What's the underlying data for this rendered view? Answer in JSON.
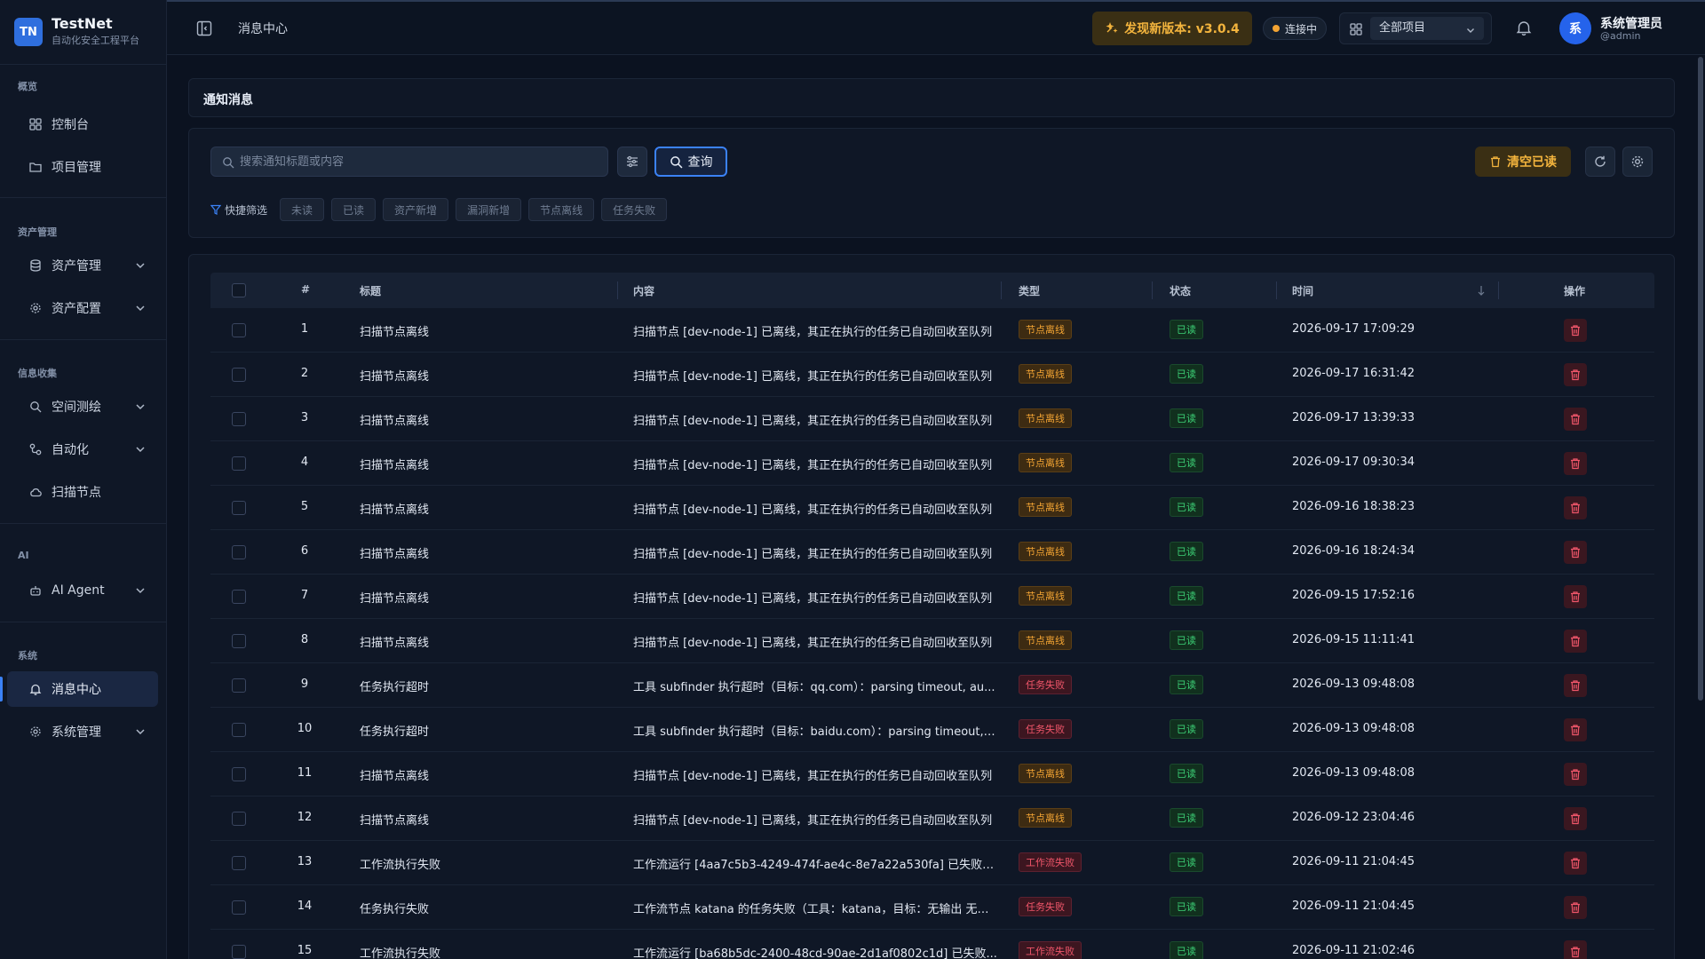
{
  "brand": {
    "logo": "TN",
    "name": "TestNet",
    "subtitle": "自动化安全工程平台"
  },
  "sidebar": {
    "groups": [
      {
        "label": "概览",
        "items": [
          {
            "label": "控制台",
            "icon": "dashboard-icon"
          },
          {
            "label": "项目管理",
            "icon": "folder-icon"
          }
        ]
      },
      {
        "label": "资产管理",
        "items": [
          {
            "label": "资产管理",
            "icon": "database-icon",
            "expandable": true
          },
          {
            "label": "资产配置",
            "icon": "gear-icon",
            "expandable": true
          }
        ]
      },
      {
        "label": "信息收集",
        "items": [
          {
            "label": "空间测绘",
            "icon": "search-icon",
            "expandable": true
          },
          {
            "label": "自动化",
            "icon": "workflow-icon",
            "expandable": true
          },
          {
            "label": "扫描节点",
            "icon": "cloud-icon"
          }
        ]
      },
      {
        "label": "AI",
        "items": [
          {
            "label": "AI Agent",
            "icon": "robot-icon",
            "expandable": true
          }
        ]
      },
      {
        "label": "系统",
        "items": [
          {
            "label": "消息中心",
            "icon": "bell-icon",
            "active": true
          },
          {
            "label": "系统管理",
            "icon": "gear-icon",
            "expandable": true
          }
        ]
      }
    ]
  },
  "header": {
    "title": "消息中心",
    "update_label": "发现新版本: v3.0.4",
    "connection_label": "连接中",
    "project_selected": "全部项目",
    "user_avatar": "系",
    "user_name": "系统管理员",
    "user_handle": "@admin"
  },
  "page": {
    "panel_title": "通知消息"
  },
  "toolbar": {
    "search_placeholder": "搜索通知标题或内容",
    "query_label": "查询",
    "clear_label": "清空已读",
    "quick_filter_label": "快捷筛选",
    "chips": [
      "未读",
      "已读",
      "资产新增",
      "漏洞新增",
      "节点离线",
      "任务失败"
    ]
  },
  "table": {
    "columns": {
      "index": "#",
      "title": "标题",
      "content": "内容",
      "type": "类型",
      "status": "状态",
      "time": "时间",
      "actions": "操作"
    },
    "rows": [
      {
        "num": "1",
        "title": "扫描节点离线",
        "content": "扫描节点 [dev-node-1] 已离线，其正在执行的任务已自动回收至队列",
        "type": "节点离线",
        "kind": "node",
        "status": "已读",
        "time": "2026-09-17 17:09:29"
      },
      {
        "num": "2",
        "title": "扫描节点离线",
        "content": "扫描节点 [dev-node-1] 已离线，其正在执行的任务已自动回收至队列",
        "type": "节点离线",
        "kind": "node",
        "status": "已读",
        "time": "2026-09-17 16:31:42"
      },
      {
        "num": "3",
        "title": "扫描节点离线",
        "content": "扫描节点 [dev-node-1] 已离线，其正在执行的任务已自动回收至队列",
        "type": "节点离线",
        "kind": "node",
        "status": "已读",
        "time": "2026-09-17 13:39:33"
      },
      {
        "num": "4",
        "title": "扫描节点离线",
        "content": "扫描节点 [dev-node-1] 已离线，其正在执行的任务已自动回收至队列",
        "type": "节点离线",
        "kind": "node",
        "status": "已读",
        "time": "2026-09-17 09:30:34"
      },
      {
        "num": "5",
        "title": "扫描节点离线",
        "content": "扫描节点 [dev-node-1] 已离线，其正在执行的任务已自动回收至队列",
        "type": "节点离线",
        "kind": "node",
        "status": "已读",
        "time": "2026-09-16 18:38:23"
      },
      {
        "num": "6",
        "title": "扫描节点离线",
        "content": "扫描节点 [dev-node-1] 已离线，其正在执行的任务已自动回收至队列",
        "type": "节点离线",
        "kind": "node",
        "status": "已读",
        "time": "2026-09-16 18:24:34"
      },
      {
        "num": "7",
        "title": "扫描节点离线",
        "content": "扫描节点 [dev-node-1] 已离线，其正在执行的任务已自动回收至队列",
        "type": "节点离线",
        "kind": "node",
        "status": "已读",
        "time": "2026-09-15 17:52:16"
      },
      {
        "num": "8",
        "title": "扫描节点离线",
        "content": "扫描节点 [dev-node-1] 已离线，其正在执行的任务已自动回收至队列",
        "type": "节点离线",
        "kind": "node",
        "status": "已读",
        "time": "2026-09-15 11:11:41"
      },
      {
        "num": "9",
        "title": "任务执行超时",
        "content": "工具 subfinder 执行超时（目标：qq.com）：parsing timeout, au...",
        "type": "任务失败",
        "kind": "task",
        "status": "已读",
        "time": "2026-09-13 09:48:08"
      },
      {
        "num": "10",
        "title": "任务执行超时",
        "content": "工具 subfinder 执行超时（目标：baidu.com）：parsing timeout, ...",
        "type": "任务失败",
        "kind": "task",
        "status": "已读",
        "time": "2026-09-13 09:48:08"
      },
      {
        "num": "11",
        "title": "扫描节点离线",
        "content": "扫描节点 [dev-node-1] 已离线，其正在执行的任务已自动回收至队列",
        "type": "节点离线",
        "kind": "node",
        "status": "已读",
        "time": "2026-09-13 09:48:08"
      },
      {
        "num": "12",
        "title": "扫描节点离线",
        "content": "扫描节点 [dev-node-1] 已离线，其正在执行的任务已自动回收至队列",
        "type": "节点离线",
        "kind": "node",
        "status": "已读",
        "time": "2026-09-12 23:04:46"
      },
      {
        "num": "13",
        "title": "工作流执行失败",
        "content": "工作流运行 [4aa7c5b3-4249-474f-ae4c-8e7a22a530fa] 已失败终...",
        "type": "工作流失败",
        "kind": "flow",
        "status": "已读",
        "time": "2026-09-11 21:04:45"
      },
      {
        "num": "14",
        "title": "任务执行失败",
        "content": "工作流节点 katana 的任务失败（工具：katana，目标：无输出 无输...",
        "type": "任务失败",
        "kind": "task",
        "status": "已读",
        "time": "2026-09-11 21:04:45"
      },
      {
        "num": "15",
        "title": "工作流执行失败",
        "content": "工作流运行 [ba68b5dc-2400-48cd-90ae-2d1af0802c1d] 已失败...",
        "type": "工作流失败",
        "kind": "flow",
        "status": "已读",
        "time": "2026-09-11 21:02:46"
      }
    ]
  },
  "colors": {
    "accent": "#3b82f6",
    "warning": "#f3a433",
    "danger": "#f0566a",
    "success": "#3ccf75"
  }
}
